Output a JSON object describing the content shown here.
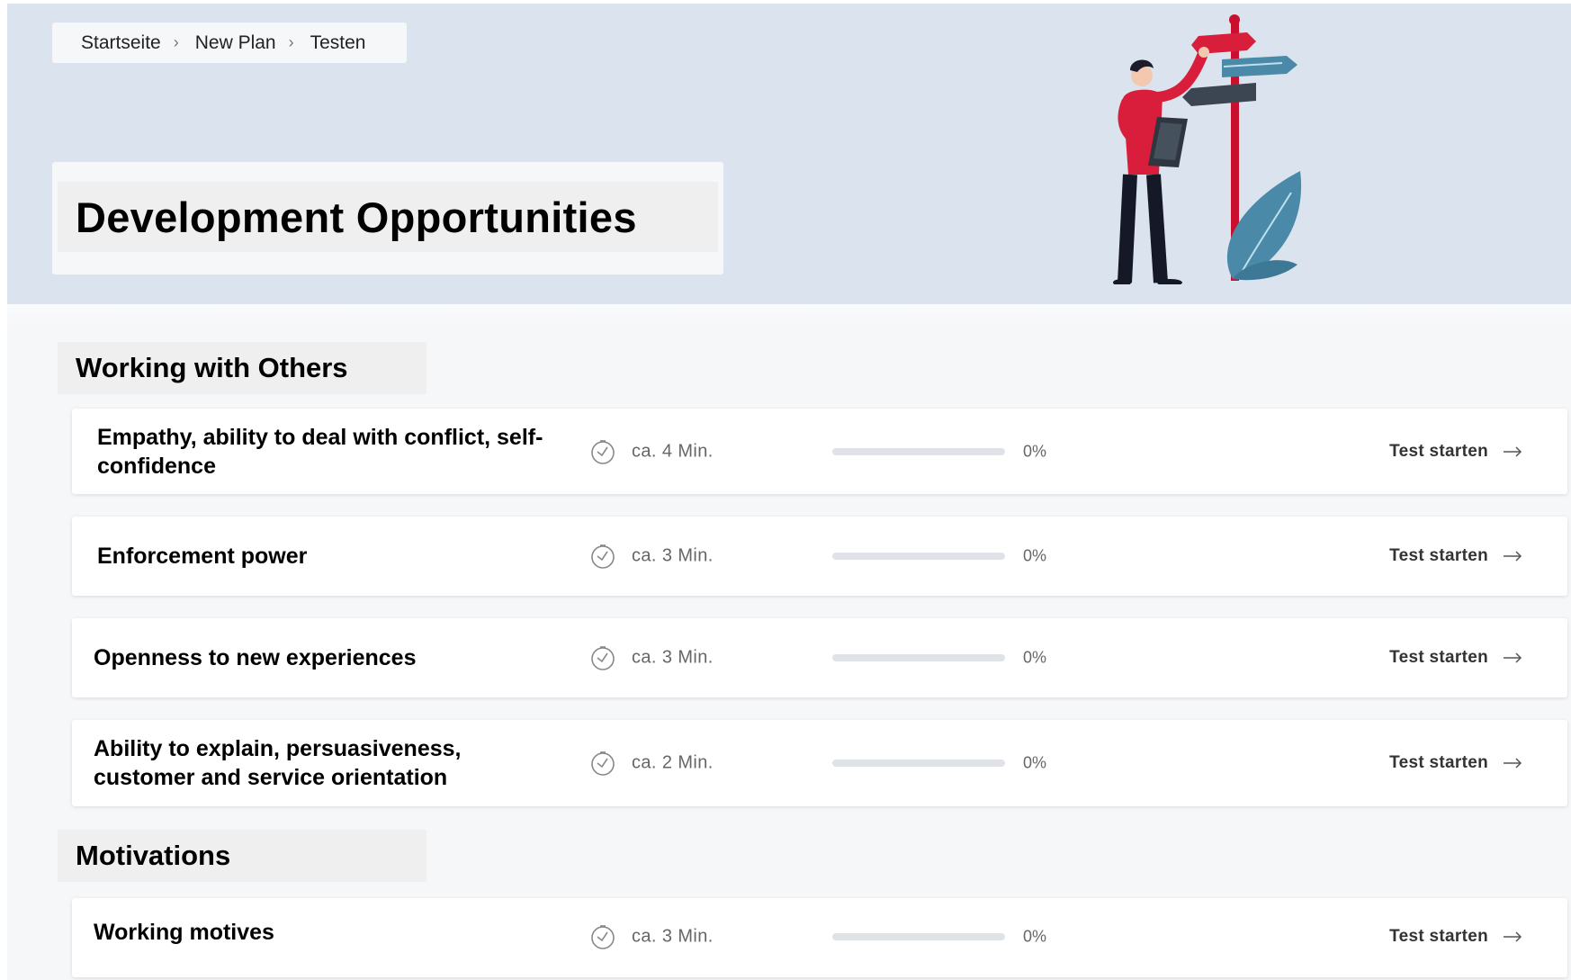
{
  "breadcrumb": {
    "items": [
      "Startseite",
      "New Plan",
      "Testen"
    ],
    "separator": "›"
  },
  "page": {
    "title": "Development Opportunities"
  },
  "sections": [
    {
      "heading": "Working with Others",
      "items": [
        {
          "title": "Empathy, ability to deal with conflict, self-confidence",
          "duration": "ca. 4 Min.",
          "progress_percent": 0,
          "progress_label": "0%",
          "action": "Test starten"
        },
        {
          "title": "Enforcement power",
          "duration": "ca. 3 Min.",
          "progress_percent": 0,
          "progress_label": "0%",
          "action": "Test starten"
        },
        {
          "title": "Openness to new experiences",
          "duration": "ca. 3 Min.",
          "progress_percent": 0,
          "progress_label": "0%",
          "action": "Test starten"
        },
        {
          "title": "Ability to explain, persuasiveness, customer and service orientation",
          "duration": "ca. 2 Min.",
          "progress_percent": 0,
          "progress_label": "0%",
          "action": "Test starten"
        }
      ]
    },
    {
      "heading": "Motivations",
      "items": [
        {
          "title": "Working motives",
          "duration": "ca. 3 Min.",
          "progress_percent": 0,
          "progress_label": "0%",
          "action": "Test starten"
        }
      ]
    }
  ],
  "icons": {
    "clock": "clock-icon",
    "arrow": "arrow-right-icon"
  },
  "colors": {
    "hero_bg": "#dbe3ee",
    "content_bg": "#f6f7f9",
    "accent_red": "#d81e3a",
    "accent_teal": "#4a8aa8"
  }
}
